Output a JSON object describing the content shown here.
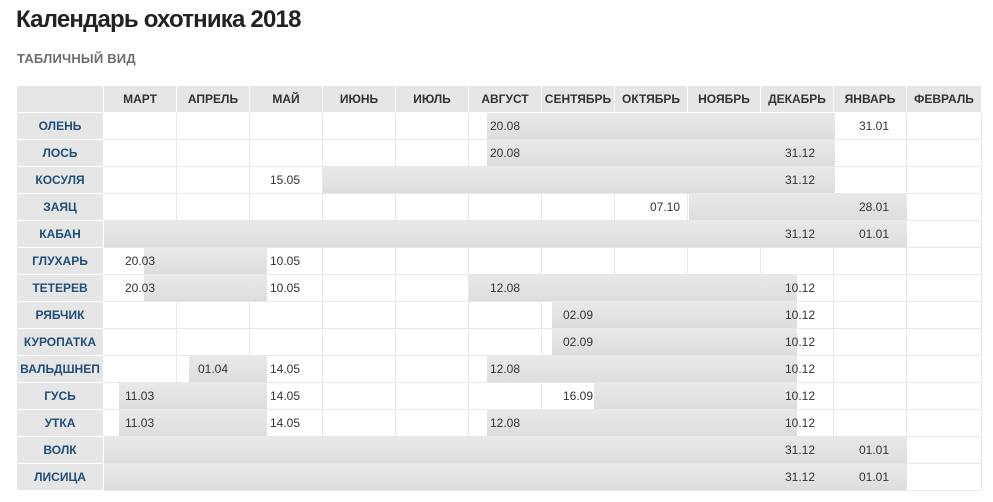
{
  "title": "Календарь охотника 2018",
  "subtitle": "ТАБЛИЧНЫЙ ВИД",
  "months": [
    "МАРТ",
    "АПРЕЛЬ",
    "МАЙ",
    "ИЮНЬ",
    "ИЮЛЬ",
    "АВГУСТ",
    "СЕНТЯБРЬ",
    "ОКТЯБРЬ",
    "НОЯБРЬ",
    "ДЕКАБРЬ",
    "ЯНВАРЬ",
    "ФЕВРАЛЬ"
  ],
  "rows": [
    {
      "animal": "ОЛЕНЬ",
      "open": "20.08",
      "close": "31.01"
    },
    {
      "animal": "ЛОСЬ",
      "open": "20.08",
      "close": "31.12"
    },
    {
      "animal": "КОСУЛЯ",
      "open": "15.05",
      "close": "31.12"
    },
    {
      "animal": "ЗАЯЦ",
      "open": "07.10",
      "close": "28.01"
    },
    {
      "animal": "КАБАН",
      "open": "",
      "close": "31.12",
      "extra": "01.01"
    },
    {
      "animal": "ГЛУХАРЬ",
      "open": "20.03",
      "close": "10.05"
    },
    {
      "animal": "ТЕТЕРЕВ",
      "open": "20.03",
      "close": "10.05",
      "open2": "12.08",
      "close2": "10.12"
    },
    {
      "animal": "РЯБЧИК",
      "open": "02.09",
      "close": "10.12"
    },
    {
      "animal": "КУРОПАТКА",
      "open": "02.09",
      "close": "10.12"
    },
    {
      "animal": "ВАЛЬДШНЕП",
      "open": "01.04",
      "close": "14.05",
      "open2": "12.08",
      "close2": "10.12"
    },
    {
      "animal": "ГУСЬ",
      "open": "11.03",
      "close": "14.05",
      "open2": "16.09",
      "close2": "10.12"
    },
    {
      "animal": "УТКА",
      "open": "11.03",
      "close": "14.05",
      "open2": "12.08",
      "close2": "10.12"
    },
    {
      "animal": "ВОЛК",
      "open": "",
      "close": "31.12",
      "extra": "01.01"
    },
    {
      "animal": "ЛИСИЦА",
      "open": "",
      "close": "31.12",
      "extra": "01.01"
    }
  ],
  "colors": {
    "band": "#e2e2e2",
    "animal_text": "#1f4e79",
    "header_bg": "#e6e6e6"
  }
}
